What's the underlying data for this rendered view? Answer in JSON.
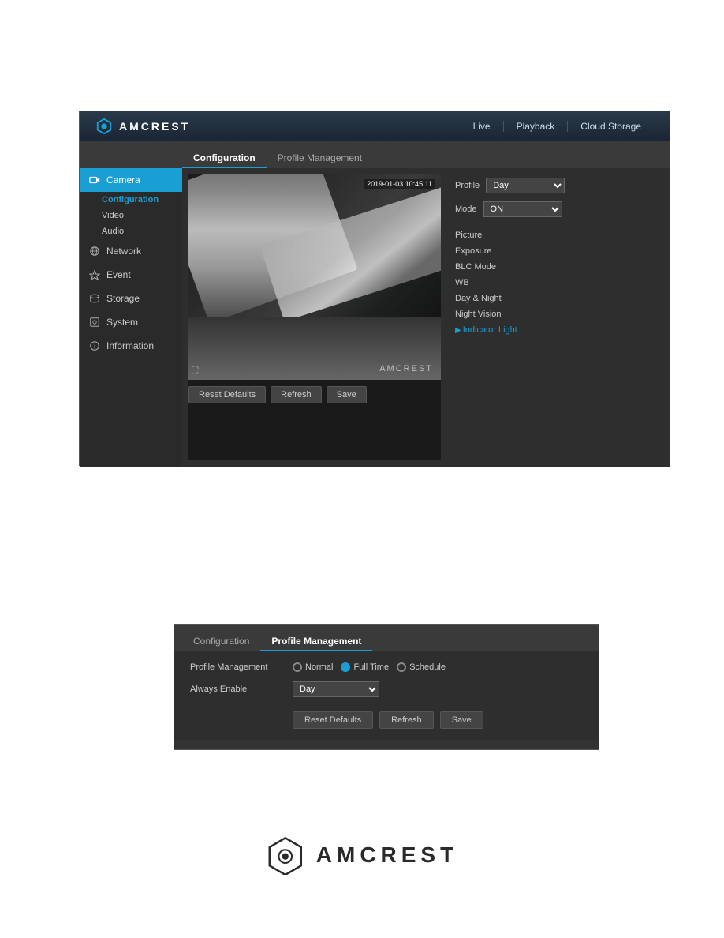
{
  "header": {
    "logo_text": "AMCREST",
    "nav": {
      "live": "Live",
      "playback": "Playback",
      "cloud_storage": "Cloud Storage"
    }
  },
  "tabs": {
    "configuration": "Configuration",
    "profile_management": "Profile Management"
  },
  "sidebar": {
    "camera": "Camera",
    "camera_sub": {
      "configuration": "Configuration",
      "video": "Video",
      "audio": "Audio"
    },
    "network": "Network",
    "event": "Event",
    "storage": "Storage",
    "system": "System",
    "information": "Information"
  },
  "video": {
    "timestamp": "2019-01-03 10:45:11",
    "watermark": "AMCREST"
  },
  "settings": {
    "profile_label": "Profile",
    "profile_value": "Day",
    "mode_label": "Mode",
    "mode_value": "ON",
    "items": [
      {
        "label": "Picture"
      },
      {
        "label": "Exposure"
      },
      {
        "label": "BLC Mode"
      },
      {
        "label": "WB"
      },
      {
        "label": "Day & Night"
      },
      {
        "label": "Night Vision"
      },
      {
        "label": "Indicator Light",
        "active": true
      }
    ]
  },
  "buttons": {
    "reset_defaults": "Reset Defaults",
    "refresh": "Refresh",
    "save": "Save"
  },
  "profile_management": {
    "tab_config": "Configuration",
    "tab_profile": "Profile Management",
    "pm_label": "Profile Management",
    "options": [
      "Normal",
      "Full Time",
      "Schedule"
    ],
    "selected_option": "Full Time",
    "always_enable_label": "Always Enable",
    "always_enable_value": "Day",
    "reset_defaults": "Reset Defaults",
    "refresh": "Refresh",
    "save": "Save"
  },
  "bottom_logo": {
    "text": "AMCREST"
  }
}
